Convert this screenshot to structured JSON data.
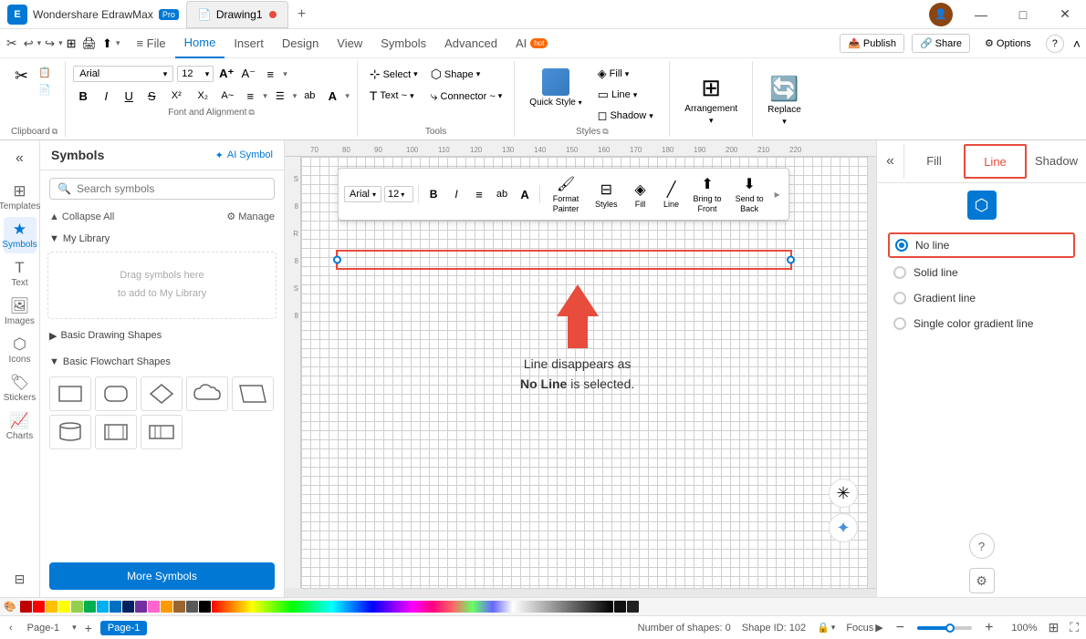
{
  "titlebar": {
    "app_name": "Wondershare EdrawMax",
    "pro_badge": "Pro",
    "doc_name": "Drawing1",
    "close_dot_color": "#e74c3c",
    "win_min": "—",
    "win_max": "□",
    "win_close": "✕",
    "new_tab": "+"
  },
  "ribbon": {
    "tabs": [
      "Home",
      "Insert",
      "Design",
      "View",
      "Symbols",
      "Advanced",
      "AI"
    ],
    "active_tab": "Home",
    "ai_badge": "hot",
    "quick_access": [
      "↩",
      "↪",
      "⊞",
      "🖨",
      "⬆"
    ],
    "actions": [
      {
        "label": "Publish",
        "icon": "📤"
      },
      {
        "label": "Share",
        "icon": "🔗"
      },
      {
        "label": "Options",
        "icon": "⚙"
      },
      {
        "label": "?",
        "icon": "?"
      }
    ]
  },
  "ribbon_groups": {
    "clipboard": {
      "label": "Clipboard",
      "items": [
        "✂",
        "📋",
        "📄",
        "📊",
        "🖌"
      ]
    },
    "font_alignment": {
      "label": "Font and Alignment",
      "font_name": "Arial",
      "font_size": "12",
      "format_btns": [
        "B",
        "I",
        "U",
        "S",
        "X²",
        "X₂",
        "A~",
        "≡",
        "☰",
        "ab",
        "A"
      ],
      "align_btns": [
        "≡",
        "▲",
        "⬆",
        "⬇"
      ]
    },
    "tools": {
      "label": "Tools",
      "select_label": "Select",
      "shape_label": "Shape",
      "text_label": "Text ~",
      "connector_label": "Connector ~"
    },
    "styles": {
      "label": "Styles",
      "quick_style_label": "Quick Style",
      "fill_label": "Fill ~",
      "line_label": "Line ~",
      "shadow_label": "Shadow ~"
    },
    "arrangement": {
      "label": "Arrangement",
      "icon": "⊞"
    },
    "replace": {
      "label": "Replace",
      "icon": "🔄"
    }
  },
  "sidebar": {
    "icons": [
      {
        "id": "collapse",
        "icon": "«",
        "label": ""
      },
      {
        "id": "templates",
        "icon": "⊞",
        "label": "Templates"
      },
      {
        "id": "symbols",
        "icon": "★",
        "label": "Symbols",
        "active": true
      },
      {
        "id": "text",
        "icon": "T",
        "label": "Text"
      },
      {
        "id": "images",
        "icon": "🖼",
        "label": "Images"
      },
      {
        "id": "icons",
        "icon": "⬡",
        "label": "Icons"
      },
      {
        "id": "stickers",
        "icon": "🏷",
        "label": "Stickers"
      },
      {
        "id": "charts",
        "icon": "📈",
        "label": "Charts"
      },
      {
        "id": "pages",
        "icon": "⊟",
        "label": ""
      }
    ]
  },
  "symbols_panel": {
    "title": "Symbols",
    "ai_label": "AI Symbol",
    "search_placeholder": "Search symbols",
    "collapse_all": "Collapse All",
    "manage": "Manage",
    "sections": [
      {
        "id": "my-library",
        "title": "My Library",
        "expanded": true,
        "empty_text": "Drag symbols here\nto add to My Library"
      },
      {
        "id": "basic-drawing",
        "title": "Basic Drawing Shapes",
        "expanded": false,
        "shapes": [
          "rect",
          "rounded-rect",
          "diamond",
          "cloud",
          "parallelogram",
          "hexagon"
        ]
      },
      {
        "id": "basic-flowchart",
        "title": "Basic Flowchart Shapes",
        "expanded": true,
        "shapes": [
          "rect",
          "rounded-rect",
          "diamond",
          "cloud",
          "trapezoid",
          "cylinder",
          "rect2",
          "process"
        ]
      }
    ],
    "more_symbols_label": "More Symbols"
  },
  "floating_toolbar": {
    "font_name": "Arial",
    "font_size": "12",
    "format_btns": [
      "B",
      "I",
      "≡",
      "ab"
    ],
    "font_color": "A",
    "tools": [
      {
        "id": "format-painter",
        "icon": "🖌",
        "label": "Format\nPainter"
      },
      {
        "id": "styles",
        "icon": "⊟",
        "label": "Styles"
      },
      {
        "id": "fill",
        "icon": "◈",
        "label": "Fill"
      },
      {
        "id": "line",
        "icon": "╱",
        "label": "Line"
      },
      {
        "id": "bring-to-front",
        "icon": "⬆",
        "label": "Bring to\nFront"
      },
      {
        "id": "send-to-back",
        "icon": "⬇",
        "label": "Send to\nBack"
      }
    ],
    "close_btn": "×"
  },
  "canvas": {
    "ruler_marks": [
      "70",
      "80",
      "90",
      "100",
      "110",
      "120",
      "130",
      "140",
      "150",
      "160",
      "170",
      "180",
      "190",
      "200",
      "210",
      "220"
    ],
    "v_ruler_marks": [
      "S",
      "8",
      "R",
      "8",
      "S",
      "8"
    ],
    "annotation_line1": "Line disappears as",
    "annotation_bold": "No Line",
    "annotation_line2": " is selected."
  },
  "right_panel": {
    "tabs": [
      "Fill",
      "Line",
      "Shadow"
    ],
    "active_tab": "Line",
    "line_options": [
      {
        "id": "no-line",
        "label": "No line",
        "selected": true
      },
      {
        "id": "solid-line",
        "label": "Solid line",
        "selected": false
      },
      {
        "id": "gradient-line",
        "label": "Gradient line",
        "selected": false
      },
      {
        "id": "single-color-gradient",
        "label": "Single color gradient line",
        "selected": false
      }
    ]
  },
  "status_bar": {
    "nav_left": "‹",
    "nav_right": "›",
    "page_name": "Page-1",
    "add_page": "+",
    "active_page": "Page-1",
    "info_left": "Number of shapes: 0",
    "shape_id": "Shape ID: 102",
    "layer": "🔒",
    "focus": "Focus",
    "play": "▶",
    "zoom_out": "−",
    "zoom_in": "+",
    "zoom_level": "100%",
    "fit": "⊞",
    "fullscreen": "⛶"
  },
  "colors": {
    "accent_blue": "#0078d4",
    "accent_red": "#e74c3c",
    "selection_blue": "#0078d4",
    "no_line_box_red": "#e74c3c"
  },
  "color_palette": [
    "#c00000",
    "#ff0000",
    "#ffc000",
    "#ffff00",
    "#92d050",
    "#00b050",
    "#00b0f0",
    "#0070c0",
    "#002060",
    "#7030a0",
    "#ff66cc",
    "#ff9900",
    "#996633",
    "#595959",
    "#000000"
  ]
}
